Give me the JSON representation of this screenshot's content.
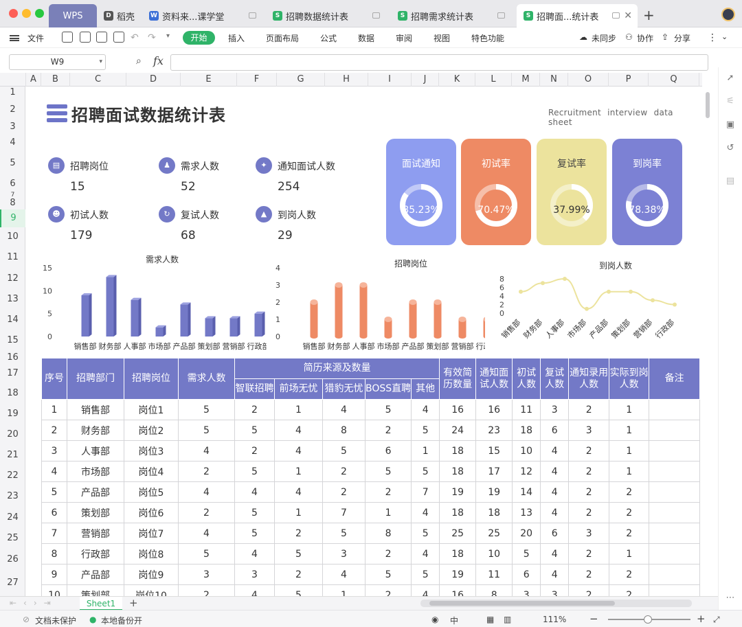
{
  "tabs": {
    "wps": "WPS",
    "items": [
      {
        "label": "稻壳"
      },
      {
        "label": "资料来...课学堂"
      },
      {
        "label": "招聘数据统计表"
      },
      {
        "label": "招聘需求统计表"
      },
      {
        "label": "招聘面...统计表"
      }
    ],
    "new_tab": "+"
  },
  "menu": {
    "file": "文件",
    "items": [
      "开始",
      "插入",
      "页面布局",
      "公式",
      "数据",
      "审阅",
      "视图",
      "特色功能"
    ],
    "sync": "未同步",
    "collab": "协作",
    "share": "分享"
  },
  "formula_bar": {
    "cell_ref": "W9",
    "fx": "fx",
    "value": ""
  },
  "columns": [
    "A",
    "B",
    "C",
    "D",
    "E",
    "F",
    "G",
    "H",
    "I",
    "J",
    "K",
    "L",
    "M",
    "N",
    "O",
    "P",
    "Q"
  ],
  "rows": [
    "1",
    "2",
    "3",
    "4",
    "5",
    "6",
    "7",
    "8",
    "9",
    "10",
    "11",
    "12",
    "13",
    "14",
    "15",
    "16",
    "17",
    "18",
    "19",
    "20",
    "21",
    "22",
    "23",
    "24",
    "25",
    "26",
    "27"
  ],
  "selected_row": "9",
  "dashboard": {
    "title": "招聘面试数据统计表",
    "subtitle": "Recruitment interview data sheet",
    "stats": [
      {
        "label": "招聘岗位",
        "value": "15",
        "icon": "doc-icon"
      },
      {
        "label": "需求人数",
        "value": "52",
        "icon": "user-icon"
      },
      {
        "label": "通知面试人数",
        "value": "254",
        "icon": "compass-icon"
      },
      {
        "label": "初试人数",
        "value": "179",
        "icon": "group-icon"
      },
      {
        "label": "复试人数",
        "value": "68",
        "icon": "refresh-icon"
      },
      {
        "label": "到岗人数",
        "value": "29",
        "icon": "chart-icon"
      }
    ],
    "cards": [
      {
        "label": "面试通知",
        "value": "85.23%",
        "pct": 0.8523,
        "color": "#8e9df0"
      },
      {
        "label": "初试率",
        "value": "70.47%",
        "pct": 0.7047,
        "color": "#ee8a64"
      },
      {
        "label": "复试率",
        "value": "37.99%",
        "pct": 0.3799,
        "color": "#ece39d"
      },
      {
        "label": "到岗率",
        "value": "78.38%",
        "pct": 0.7838,
        "color": "#7c81d4"
      }
    ]
  },
  "chart_data": [
    {
      "type": "bar",
      "title": "需求人数",
      "categories": [
        "销售部",
        "财务部",
        "人事部",
        "市场部",
        "产品部",
        "策划部",
        "营销部",
        "行政部"
      ],
      "values": [
        9,
        13,
        8,
        2,
        7,
        4,
        4,
        5
      ],
      "ylim": [
        0,
        15
      ],
      "yticks": [
        0,
        5,
        10,
        15
      ],
      "color": "#7379c7"
    },
    {
      "type": "bar",
      "title": "招聘岗位",
      "categories": [
        "销售部",
        "财务部",
        "人事部",
        "市场部",
        "产品部",
        "策划部",
        "营销部",
        "行政部"
      ],
      "values": [
        2,
        3,
        3,
        1,
        2,
        2,
        1,
        1
      ],
      "ylim": [
        0,
        4
      ],
      "yticks": [
        0,
        1,
        2,
        3,
        4
      ],
      "color": "#ee8a64"
    },
    {
      "type": "line",
      "title": "到岗人数",
      "categories": [
        "销售部",
        "财务部",
        "人事部",
        "市场部",
        "产品部",
        "策划部",
        "营销部",
        "行政部"
      ],
      "values": [
        5,
        7,
        8,
        1,
        5,
        5,
        3,
        2
      ],
      "ylim": [
        0,
        8
      ],
      "yticks": [
        0,
        2,
        4,
        6,
        8
      ],
      "color": "#ece39d"
    }
  ],
  "table": {
    "headers": {
      "no": "序号",
      "dept": "招聘部门",
      "post": "招聘岗位",
      "need": "需求人数",
      "source": "简历来源及数量",
      "src": [
        "智联招聘",
        "前场无忧",
        "猎豹无忧",
        "BOSS直聘",
        "其他"
      ],
      "valid": "有效简历数量",
      "notify": "通知面试人数",
      "first": "初试人数",
      "second": "复试人数",
      "hire": "通知录用人数",
      "arrive": "实际到岗人数",
      "note": "备注"
    },
    "rows": [
      [
        "1",
        "销售部",
        "岗位1",
        "5",
        "2",
        "1",
        "4",
        "5",
        "4",
        "16",
        "16",
        "11",
        "3",
        "2",
        "1",
        ""
      ],
      [
        "2",
        "财务部",
        "岗位2",
        "5",
        "5",
        "4",
        "8",
        "2",
        "5",
        "24",
        "23",
        "18",
        "6",
        "3",
        "1",
        ""
      ],
      [
        "3",
        "人事部",
        "岗位3",
        "4",
        "2",
        "4",
        "5",
        "6",
        "1",
        "18",
        "15",
        "10",
        "4",
        "2",
        "1",
        ""
      ],
      [
        "4",
        "市场部",
        "岗位4",
        "2",
        "5",
        "1",
        "2",
        "5",
        "5",
        "18",
        "17",
        "12",
        "4",
        "2",
        "1",
        ""
      ],
      [
        "5",
        "产品部",
        "岗位5",
        "4",
        "4",
        "4",
        "2",
        "2",
        "7",
        "19",
        "19",
        "14",
        "4",
        "2",
        "2",
        ""
      ],
      [
        "6",
        "策划部",
        "岗位6",
        "2",
        "5",
        "1",
        "7",
        "1",
        "4",
        "18",
        "18",
        "13",
        "4",
        "2",
        "2",
        ""
      ],
      [
        "7",
        "营销部",
        "岗位7",
        "4",
        "5",
        "2",
        "5",
        "8",
        "5",
        "25",
        "25",
        "20",
        "6",
        "3",
        "2",
        ""
      ],
      [
        "8",
        "行政部",
        "岗位8",
        "5",
        "4",
        "5",
        "3",
        "2",
        "4",
        "18",
        "10",
        "5",
        "4",
        "2",
        "1",
        ""
      ],
      [
        "9",
        "产品部",
        "岗位9",
        "3",
        "3",
        "2",
        "4",
        "5",
        "5",
        "19",
        "11",
        "6",
        "4",
        "2",
        "2",
        ""
      ],
      [
        "10",
        "策划部",
        "岗位10",
        "2",
        "4",
        "5",
        "1",
        "2",
        "4",
        "16",
        "8",
        "3",
        "3",
        "2",
        "2",
        ""
      ]
    ]
  },
  "sheet_tab": "Sheet1",
  "status": {
    "protect": "文档未保护",
    "backup": "本地备份开",
    "lang": "中",
    "zoom": "111%"
  }
}
